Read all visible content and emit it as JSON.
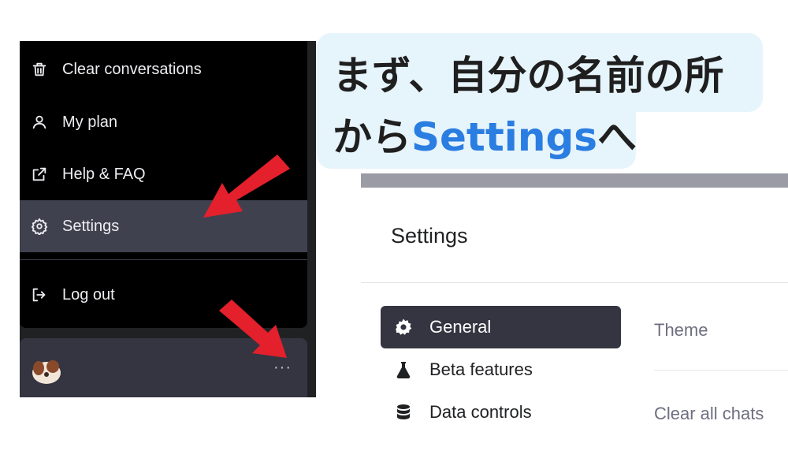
{
  "menu": {
    "items": [
      {
        "label": "Clear conversations",
        "icon": "trash-icon"
      },
      {
        "label": "My plan",
        "icon": "user-icon"
      },
      {
        "label": "Help & FAQ",
        "icon": "external-link-icon"
      },
      {
        "label": "Settings",
        "icon": "gear-icon",
        "highlighted": true
      },
      {
        "label": "Log out",
        "icon": "logout-icon"
      }
    ],
    "more_label": "···"
  },
  "caption": {
    "line1": "まず、自分の名前の所",
    "line2_prefix": "から",
    "line2_highlight": "Settings",
    "line2_suffix": "へ",
    "highlight_color": "#2a7de1",
    "background_color": "#e6f4fb"
  },
  "dialog": {
    "title": "Settings",
    "nav": [
      {
        "label": "General",
        "icon": "gear-icon",
        "selected": true
      },
      {
        "label": "Beta features",
        "icon": "flask-icon"
      },
      {
        "label": "Data controls",
        "icon": "database-icon"
      }
    ],
    "rows": [
      {
        "label": "Theme"
      },
      {
        "label": "Clear all chats"
      }
    ]
  },
  "colors": {
    "arrow": "#e3202b",
    "menu_bg": "#000000",
    "selected_menu_bg": "#40414f",
    "selected_nav_bg": "#343541"
  }
}
